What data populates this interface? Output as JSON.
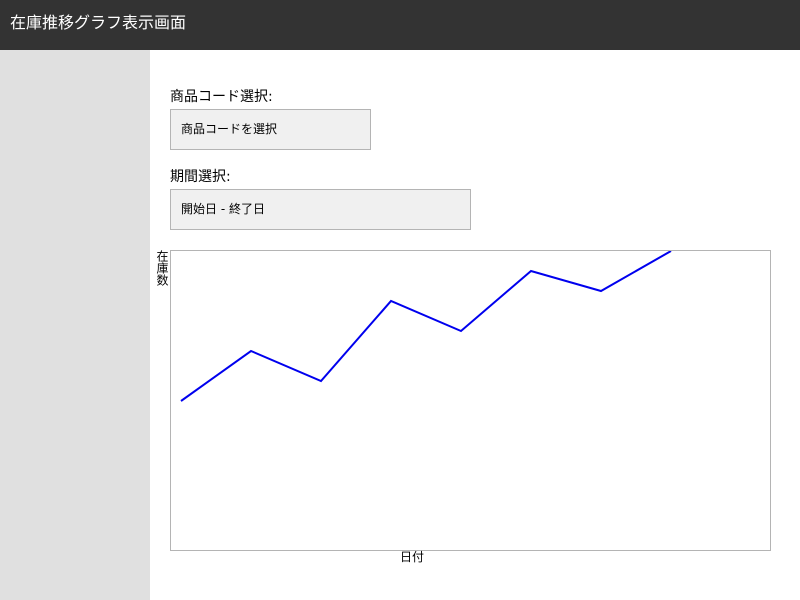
{
  "window": {
    "title": "在庫推移グラフ表示画面"
  },
  "form": {
    "product_label": "商品コード選択:",
    "product_value": "商品コードを選択",
    "period_label": "期間選択:",
    "period_value": "開始日 - 終了日"
  },
  "colors": {
    "titlebar": "#333333",
    "sidebar": "#e0e0e0",
    "line": "#0000ee"
  },
  "chart_data": {
    "type": "line",
    "title": "",
    "xlabel": "日付",
    "ylabel": "在庫数",
    "x": [
      1,
      2,
      3,
      4,
      5,
      6,
      7,
      8
    ],
    "series": [
      {
        "values": [
          15,
          20,
          17,
          25,
          22,
          28,
          26,
          30
        ]
      }
    ],
    "ylim": [
      0,
      30
    ],
    "grid": false
  }
}
